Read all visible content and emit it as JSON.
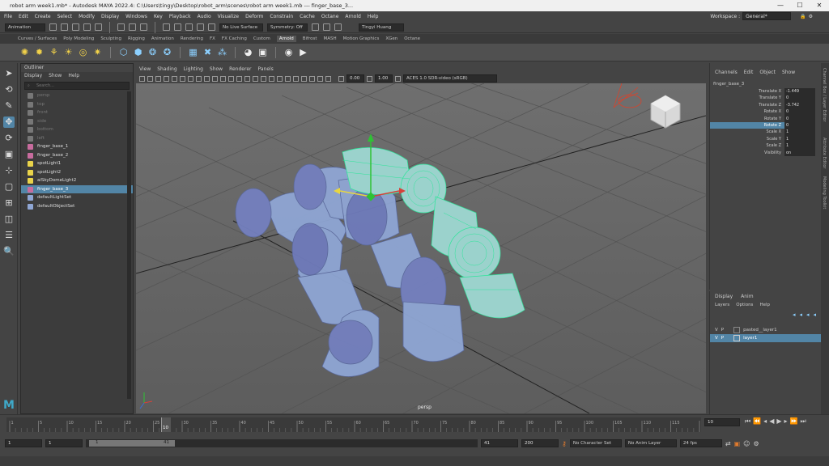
{
  "window": {
    "title": "robot arm week1.mb* - Autodesk MAYA 2022.4: C:\\Users\\tingy\\Desktop\\robot_arm\\scenes\\robot arm week1.mb --- finger_base_3..."
  },
  "menu": [
    "File",
    "Edit",
    "Create",
    "Select",
    "Modify",
    "Display",
    "Windows",
    "Key",
    "Playback",
    "Audio",
    "Visualize",
    "Deform",
    "Constrain",
    "Cache",
    "Octane",
    "Arnold",
    "Help"
  ],
  "workspace": {
    "label": "Workspace :",
    "value": "General*"
  },
  "status": {
    "mode": "Animation",
    "live_surface": "No Live Surface",
    "symmetry": "Symmetry: Off",
    "user": "Tingyi Huang"
  },
  "shelf_tabs": [
    "Curves / Surfaces",
    "Poly Modeling",
    "Sculpting",
    "Rigging",
    "Animation",
    "Rendering",
    "FX",
    "FX Caching",
    "Custom",
    "Arnold",
    "Bifrost",
    "MASH",
    "Motion Graphics",
    "XGen",
    "Octane"
  ],
  "active_shelf": "Arnold",
  "outliner": {
    "title": "Outliner",
    "menu": [
      "Display",
      "Show",
      "Help"
    ],
    "search_placeholder": "Search...",
    "items": [
      {
        "label": "persp",
        "dim": true,
        "icon": "camera-icon"
      },
      {
        "label": "top",
        "dim": true,
        "icon": "camera-icon"
      },
      {
        "label": "front",
        "dim": true,
        "icon": "camera-icon"
      },
      {
        "label": "side",
        "dim": true,
        "icon": "camera-icon"
      },
      {
        "label": "bottom",
        "dim": true,
        "icon": "camera-icon"
      },
      {
        "label": "left",
        "dim": true,
        "icon": "camera-icon"
      },
      {
        "label": "finger_base_1",
        "icon": "transform-icon"
      },
      {
        "label": "finger_base_2",
        "icon": "transform-icon"
      },
      {
        "label": "spotLight1",
        "icon": "light-icon"
      },
      {
        "label": "spotLight2",
        "icon": "light-icon"
      },
      {
        "label": "aiSkyDomeLight2",
        "icon": "light-icon"
      },
      {
        "label": "finger_base_3",
        "sel": true,
        "icon": "transform-icon"
      },
      {
        "label": "defaultLightSet",
        "icon": "set-icon"
      },
      {
        "label": "defaultObjectSet",
        "icon": "set-icon"
      }
    ]
  },
  "viewport": {
    "menu": [
      "View",
      "Shading",
      "Lighting",
      "Show",
      "Renderer",
      "Panels"
    ],
    "exposure": "0.00",
    "gamma": "1.00",
    "colorspace": "ACES 1.0 SDR-video (sRGB)",
    "camera": "persp"
  },
  "channelbox": {
    "menu": [
      "Channels",
      "Edit",
      "Object",
      "Show"
    ],
    "object": "finger_base_3",
    "attrs": [
      {
        "name": "Translate X",
        "value": "-1.449"
      },
      {
        "name": "Translate Y",
        "value": "0"
      },
      {
        "name": "Translate Z",
        "value": "-3.742"
      },
      {
        "name": "Rotate X",
        "value": "0"
      },
      {
        "name": "Rotate Y",
        "value": "0"
      },
      {
        "name": "Rotate Z",
        "value": "0",
        "hl": true
      },
      {
        "name": "Scale X",
        "value": "1"
      },
      {
        "name": "Scale Y",
        "value": "1"
      },
      {
        "name": "Scale Z",
        "value": "1"
      },
      {
        "name": "Visibility",
        "value": "on"
      }
    ]
  },
  "layers": {
    "tabs": [
      "Display",
      "Anim"
    ],
    "menu": [
      "Layers",
      "Options",
      "Help"
    ],
    "rows": [
      {
        "v": "V",
        "p": "P",
        "name": "pasted__layer1"
      },
      {
        "v": "V",
        "p": "P",
        "name": "layer1",
        "sel": true
      }
    ]
  },
  "side_tabs": [
    "Channel Box / Layer Editor",
    "Attribute Editor",
    "Modeling Toolkit"
  ],
  "timeline": {
    "ticks": [
      "1",
      "5",
      "10",
      "15",
      "20",
      "25",
      "30",
      "35",
      "40",
      "45",
      "50",
      "55",
      "60",
      "65",
      "70",
      "75",
      "80",
      "85",
      "90",
      "95",
      "100",
      "105",
      "110",
      "115",
      "120"
    ],
    "current": "10",
    "current_field": "10"
  },
  "range": {
    "start": "1",
    "start2": "1",
    "slider_val": "1",
    "slider_end": "41",
    "end": "41",
    "end2": "200",
    "char_set": "No Character Set",
    "anim_layer": "No Anim Layer",
    "fps": "24 fps"
  }
}
